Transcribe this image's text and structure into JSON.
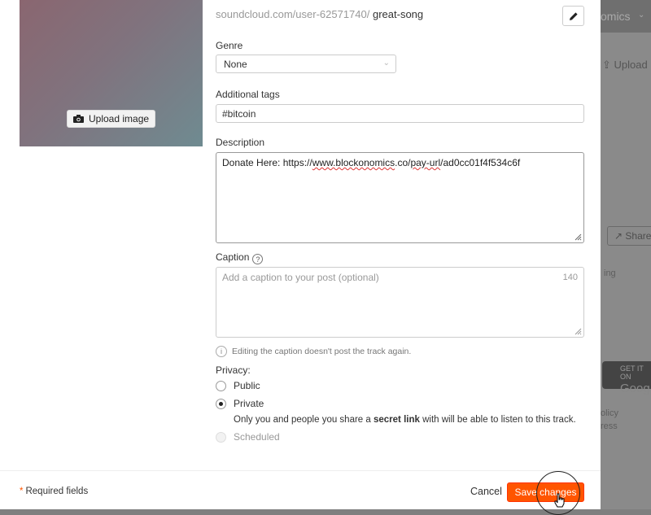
{
  "background": {
    "topbar_fragment": "omics",
    "upload_fragment": "Upload h",
    "share_fragment": "Share",
    "side_fragments": [
      "olicy",
      "ress",
      "ing"
    ],
    "google_badge_top": "GET IT ON",
    "google_badge_name": "Goog"
  },
  "artwork": {
    "upload_label": "Upload image"
  },
  "url": {
    "prefix": "soundcloud.com/user-62571740/",
    "slug": "great-song"
  },
  "genre": {
    "label": "Genre",
    "value": "None"
  },
  "tags": {
    "label": "Additional tags",
    "value": "#bitcoin"
  },
  "description": {
    "label": "Description",
    "text_prefix": "Donate Here: https://",
    "text_link": "www.blockonomics",
    "text_mid": ".co/",
    "text_link2": "pay-url",
    "text_suffix": "/ad0cc01f4f534c6f"
  },
  "caption": {
    "label": "Caption",
    "help": "?",
    "placeholder": "Add a caption to your post (optional)",
    "count": "140",
    "note_icon": "i",
    "note": "Editing the caption doesn't post the track again."
  },
  "privacy": {
    "label": "Privacy:",
    "options": [
      {
        "label": "Public",
        "checked": false
      },
      {
        "label": "Private",
        "checked": true
      },
      {
        "label": "Scheduled",
        "checked": false,
        "disabled": true
      }
    ],
    "private_desc_before": "Only you and people you share a ",
    "private_desc_bold": "secret link",
    "private_desc_after": " with will be able to listen to this track."
  },
  "footer": {
    "required_star": "*",
    "required_label": "Required fields",
    "cancel_label": "Cancel",
    "save_label": "Save changes"
  },
  "colors": {
    "accent": "#ff5500"
  }
}
